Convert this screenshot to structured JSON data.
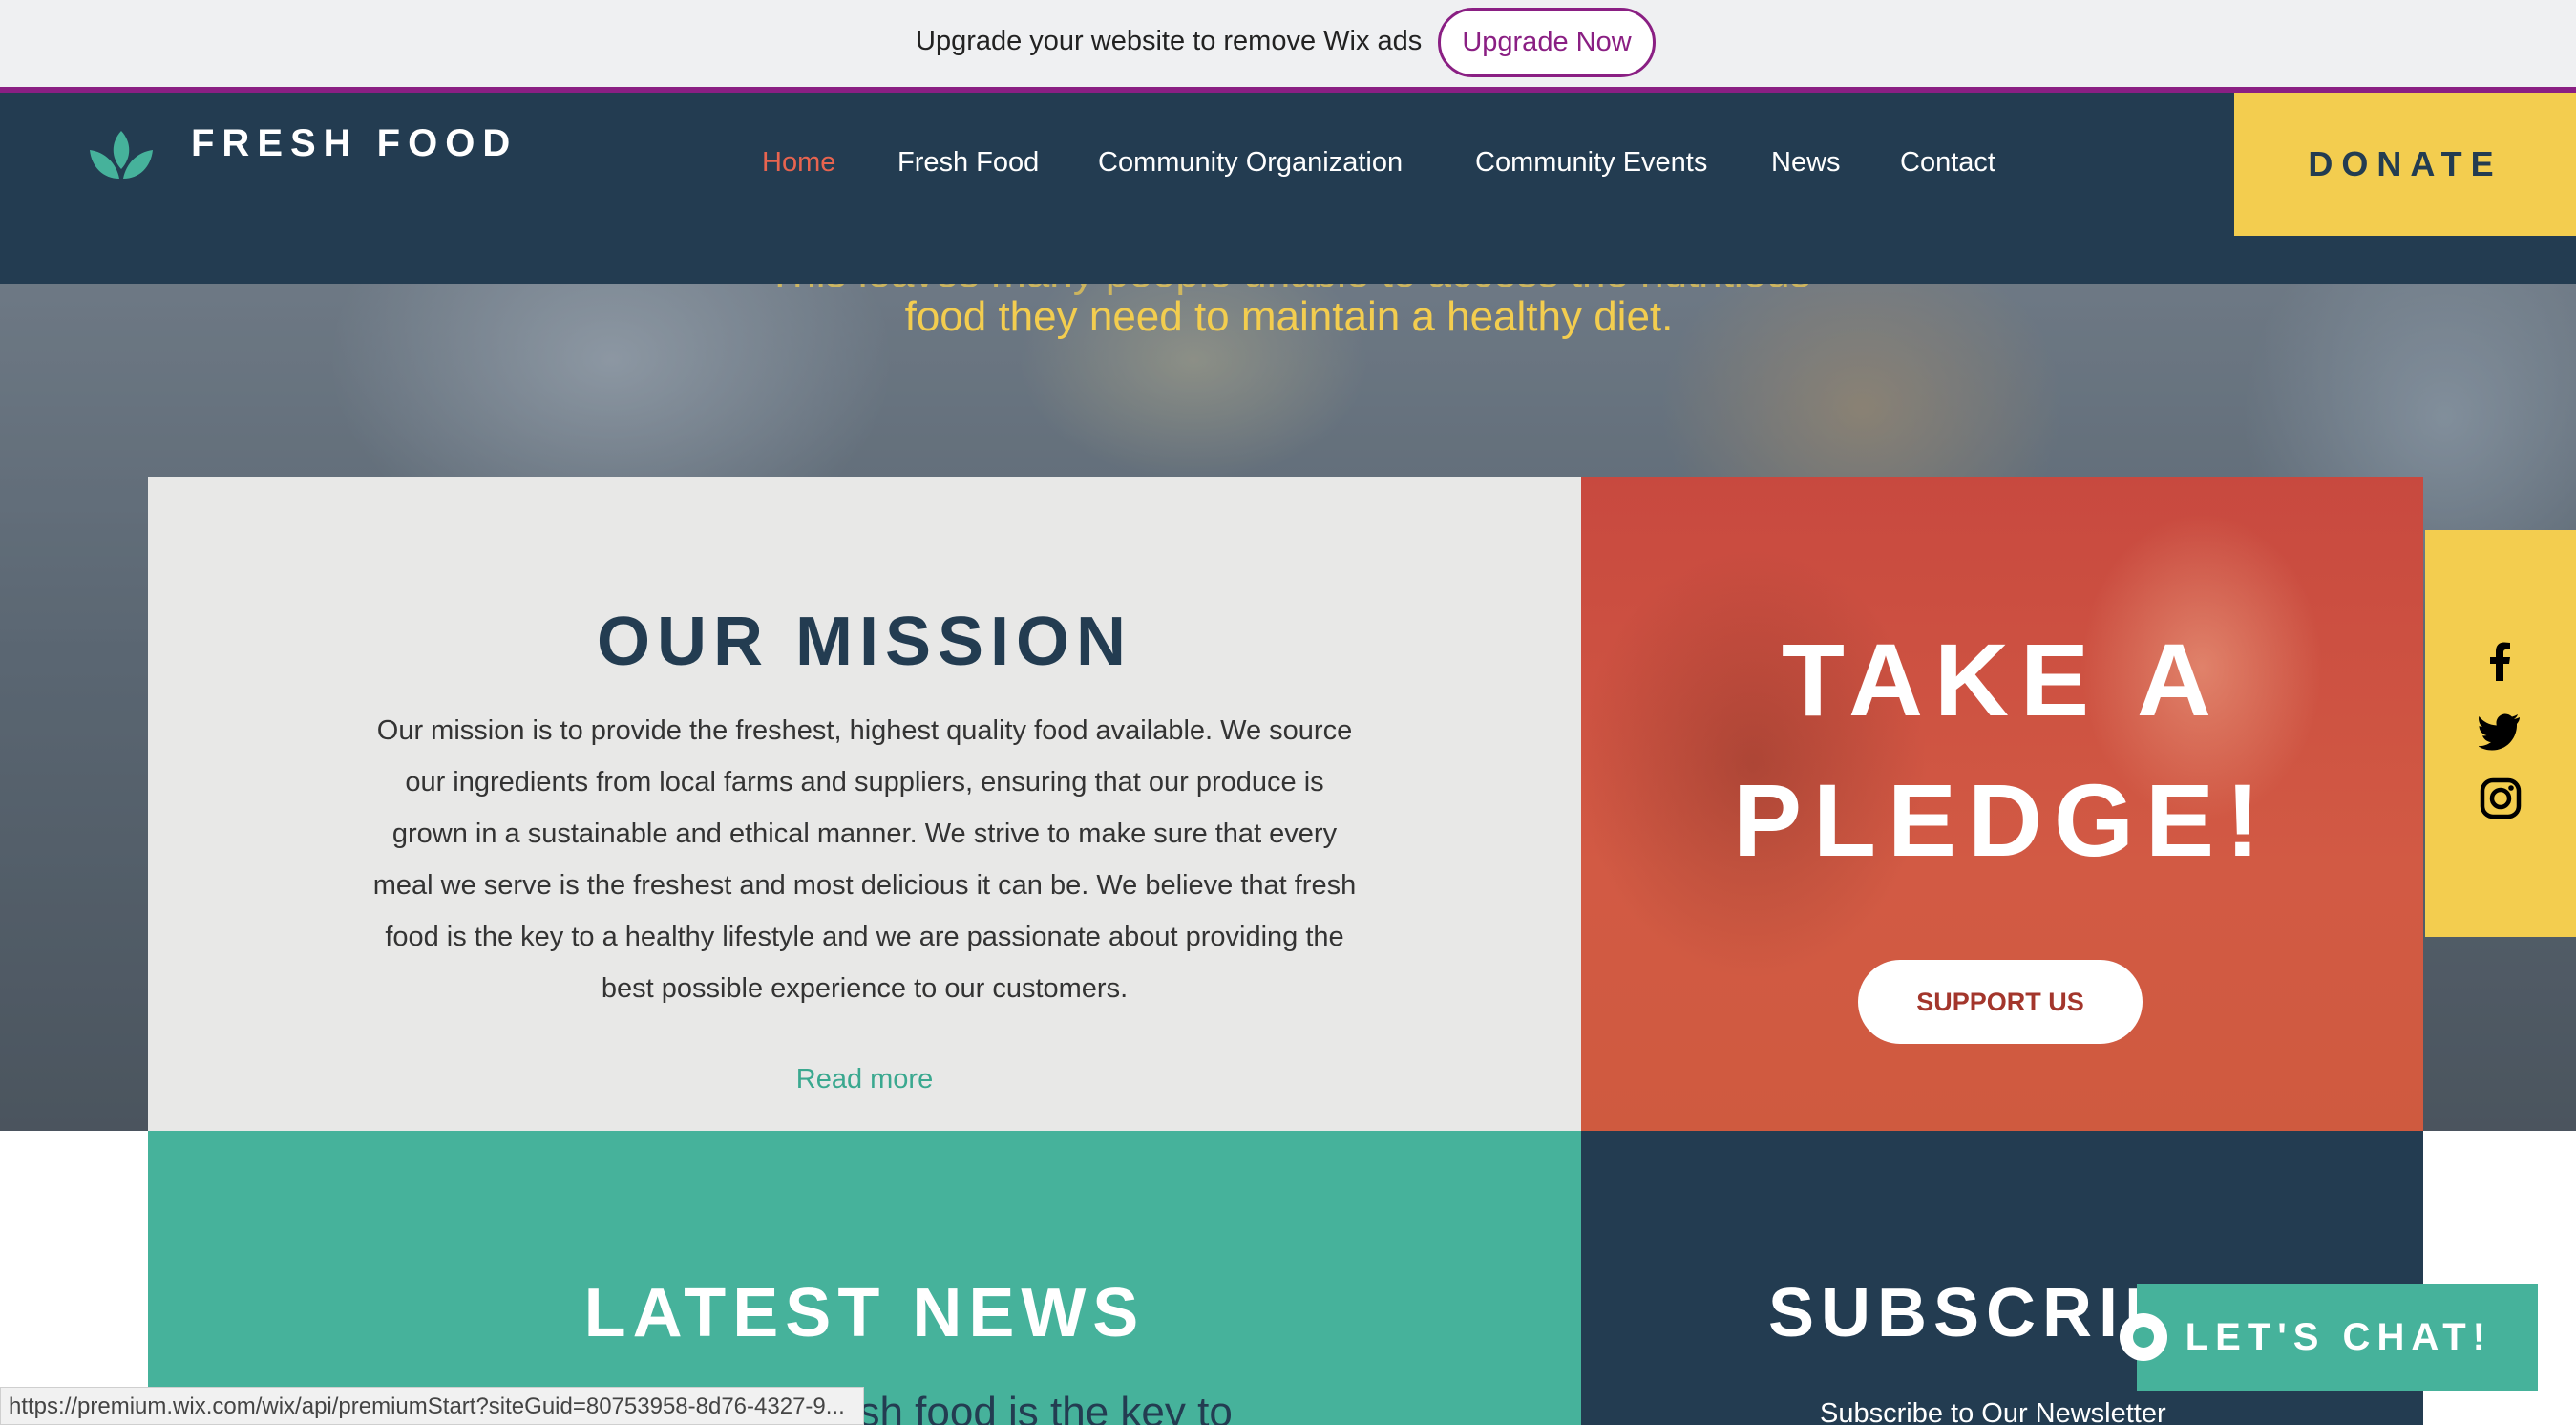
{
  "ad_bar": {
    "text": "Upgrade your website to remove Wix ads",
    "button_label": "Upgrade Now"
  },
  "header": {
    "logo_text": "FRESH FOOD",
    "nav": [
      {
        "label": "Home",
        "active": true
      },
      {
        "label": "Fresh Food"
      },
      {
        "label": "Community Organization"
      },
      {
        "label": "Community Events"
      },
      {
        "label": "News"
      },
      {
        "label": "Contact"
      }
    ],
    "donate_label": "DONATE"
  },
  "hero": {
    "partial_line": "This leaves many people unable to access the nutritious",
    "line": "food they need to maintain a healthy diet."
  },
  "mission": {
    "title": "OUR MISSION",
    "lines": [
      "Our mission is to provide the freshest, highest quality food available. We source",
      "our ingredients from local farms and suppliers, ensuring that our produce is",
      "grown in a sustainable and ethical manner. We strive to make sure that every",
      "meal we serve is the freshest and most delicious it can be. We believe that fresh",
      "food is the key to a healthy lifestyle and we are passionate about providing the",
      "best possible experience to our customers."
    ],
    "read_more": "Read more"
  },
  "pledge": {
    "line1": "TAKE A",
    "line2": "PLEDGE!",
    "button": "SUPPORT US"
  },
  "social": [
    "facebook-icon",
    "twitter-icon",
    "instagram-icon"
  ],
  "news": {
    "title": "LATEST NEWS",
    "snippet": "esh food is the key to"
  },
  "subscribe": {
    "title": "SUBSCRIBE",
    "subtitle": "Subscribe to Our Newsletter"
  },
  "chat": {
    "label": "LET'S CHAT!"
  },
  "status_url": "https://premium.wix.com/wix/api/premiumStart?siteGuid=80753958-8d76-4327-9...",
  "colors": {
    "navy": "#233c51",
    "yellow": "#f3cd4f",
    "teal": "#46b29b",
    "coral": "#e8644f",
    "wix_purple": "#8a1f83"
  }
}
